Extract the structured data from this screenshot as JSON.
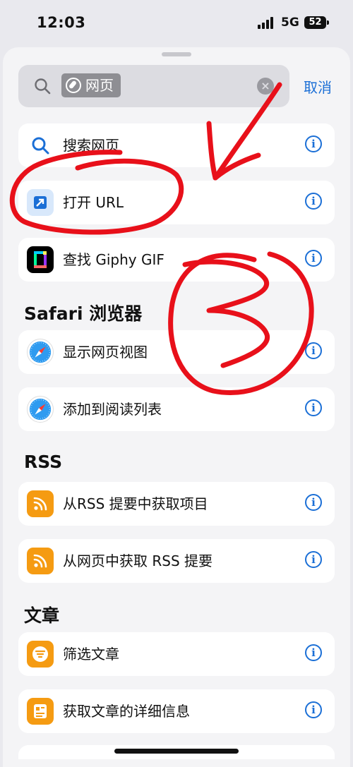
{
  "status_bar": {
    "time": "12:03",
    "network": "5G",
    "battery": "52"
  },
  "search": {
    "token_label": "网页",
    "cancel_label": "取消"
  },
  "top_results": [
    {
      "label": "搜索网页",
      "icon": "magnifier-icon"
    },
    {
      "label": "打开 URL",
      "icon": "open-url-icon"
    },
    {
      "label": "查找 Giphy GIF",
      "icon": "giphy-icon"
    }
  ],
  "sections": [
    {
      "title": "Safari 浏览器",
      "items": [
        {
          "label": "显示网页视图",
          "icon": "safari-icon"
        },
        {
          "label": "添加到阅读列表",
          "icon": "safari-icon"
        }
      ]
    },
    {
      "title": "RSS",
      "items": [
        {
          "label": "从RSS 提要中获取项目",
          "icon": "rss-icon"
        },
        {
          "label": "从网页中获取 RSS 提要",
          "icon": "rss-icon"
        }
      ]
    },
    {
      "title": "文章",
      "items": [
        {
          "label": "筛选文章",
          "icon": "article-filter-icon"
        },
        {
          "label": "获取文章的详细信息",
          "icon": "article-detail-icon"
        }
      ]
    }
  ],
  "info_glyph": "i",
  "annotation_number": "3",
  "colors": {
    "accent": "#1b6fd6",
    "annotation": "#e8101a",
    "rss": "#f59b12"
  }
}
